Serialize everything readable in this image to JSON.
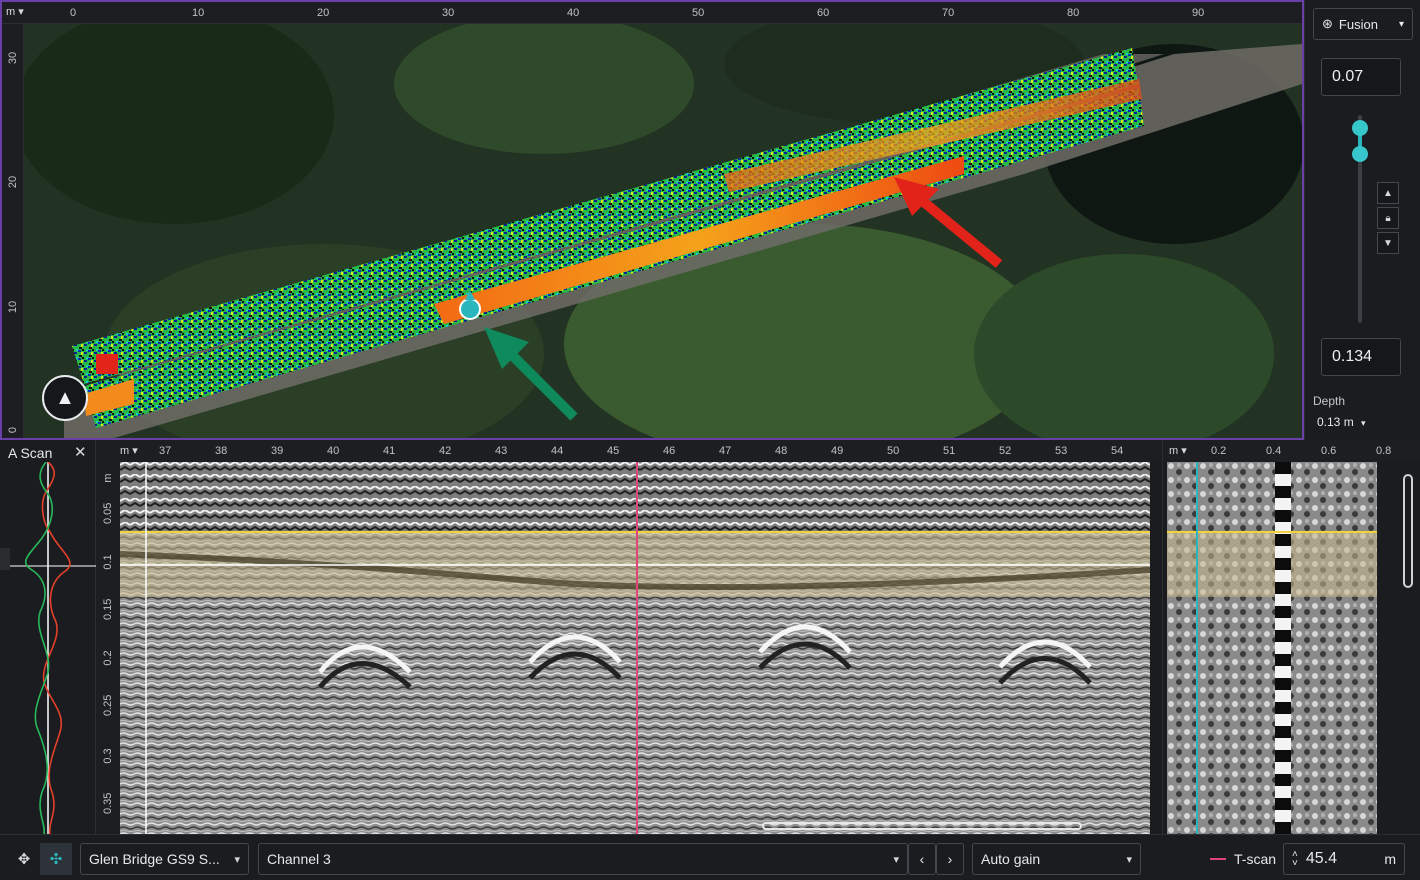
{
  "map": {
    "unit": "m",
    "x_ticks": [
      "0",
      "10",
      "20",
      "30",
      "40",
      "50",
      "60",
      "70",
      "80",
      "90"
    ],
    "y_ticks": [
      "30",
      "20",
      "10",
      "0"
    ]
  },
  "side": {
    "mode_label": "Fusion",
    "upper_value": "0.07",
    "lower_value": "0.134",
    "depth_label": "Depth",
    "depth_value": "0.13 m"
  },
  "ascan": {
    "title": "A Scan",
    "close_glyph": "✕"
  },
  "bscan": {
    "unit": "m",
    "x_ticks": [
      "37",
      "38",
      "39",
      "40",
      "41",
      "42",
      "43",
      "44",
      "45",
      "46",
      "47",
      "48",
      "49",
      "50",
      "51",
      "52",
      "53",
      "54"
    ],
    "y_unit": "m",
    "y_ticks": [
      "0.05",
      "0.1",
      "0.15",
      "0.2",
      "0.25",
      "0.3",
      "0.35"
    ]
  },
  "tscan": {
    "unit": "m",
    "x_ticks": [
      "0.2",
      "0.4",
      "0.6",
      "0.8"
    ]
  },
  "toolbar": {
    "project_select": "Glen Bridge GS9 S...",
    "channel_select": "Channel 3",
    "gain_select": "Auto gain",
    "tscan_label": "T-scan",
    "position_value": "45.4",
    "position_unit": "m"
  },
  "colors": {
    "accent_purple": "#6b3fa8",
    "accent_teal": "#2bb5bd",
    "marker_pink": "#e0457b",
    "depth_band": "#f2d13a",
    "arrow_red": "#e2231a",
    "arrow_green": "#0f8a5c"
  },
  "icons": {
    "fusion": "gear-like-icon",
    "compass": "north-arrow-icon"
  }
}
